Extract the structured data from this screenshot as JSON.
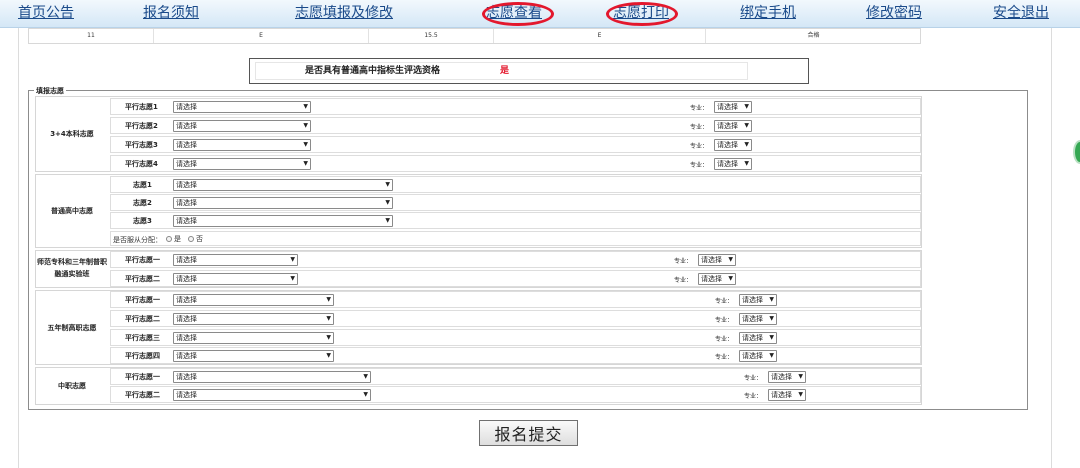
{
  "nav": {
    "items": [
      "首页公告",
      "报名须知",
      "志愿填报及修改",
      "志愿查看",
      "志愿打印",
      "绑定手机",
      "修改密码",
      "安全退出"
    ]
  },
  "score_row": [
    "11",
    "E",
    "15.5",
    "E",
    "合格"
  ],
  "eligibility": {
    "label": "是否具有普通高中指标生评选资格",
    "value": "是"
  },
  "fieldset_legend": "填报志愿",
  "select_placeholder": "请选择",
  "major_label": "专业：",
  "groups": [
    {
      "label": "3+4本科志愿",
      "rows": [
        "平行志愿1",
        "平行志愿2",
        "平行志愿3",
        "平行志愿4"
      ]
    },
    {
      "label": "普通高中志愿",
      "rows": [
        "志愿1",
        "志愿2",
        "志愿3"
      ]
    },
    {
      "label": "师范专科和三年制普职融通实验班",
      "rows": [
        "平行志愿一",
        "平行志愿二"
      ]
    },
    {
      "label": "五年制高职志愿",
      "rows": [
        "平行志愿一",
        "平行志愿二",
        "平行志愿三",
        "平行志愿四"
      ]
    },
    {
      "label": "中职志愿",
      "rows": [
        "平行志愿一",
        "平行志愿二"
      ]
    }
  ],
  "obey": {
    "label": "是否服从分配：",
    "yes": "是",
    "no": "否"
  },
  "submit_label": "报名提交",
  "colors": {
    "highlight": "#e3182d",
    "link": "#1a4a8a"
  }
}
